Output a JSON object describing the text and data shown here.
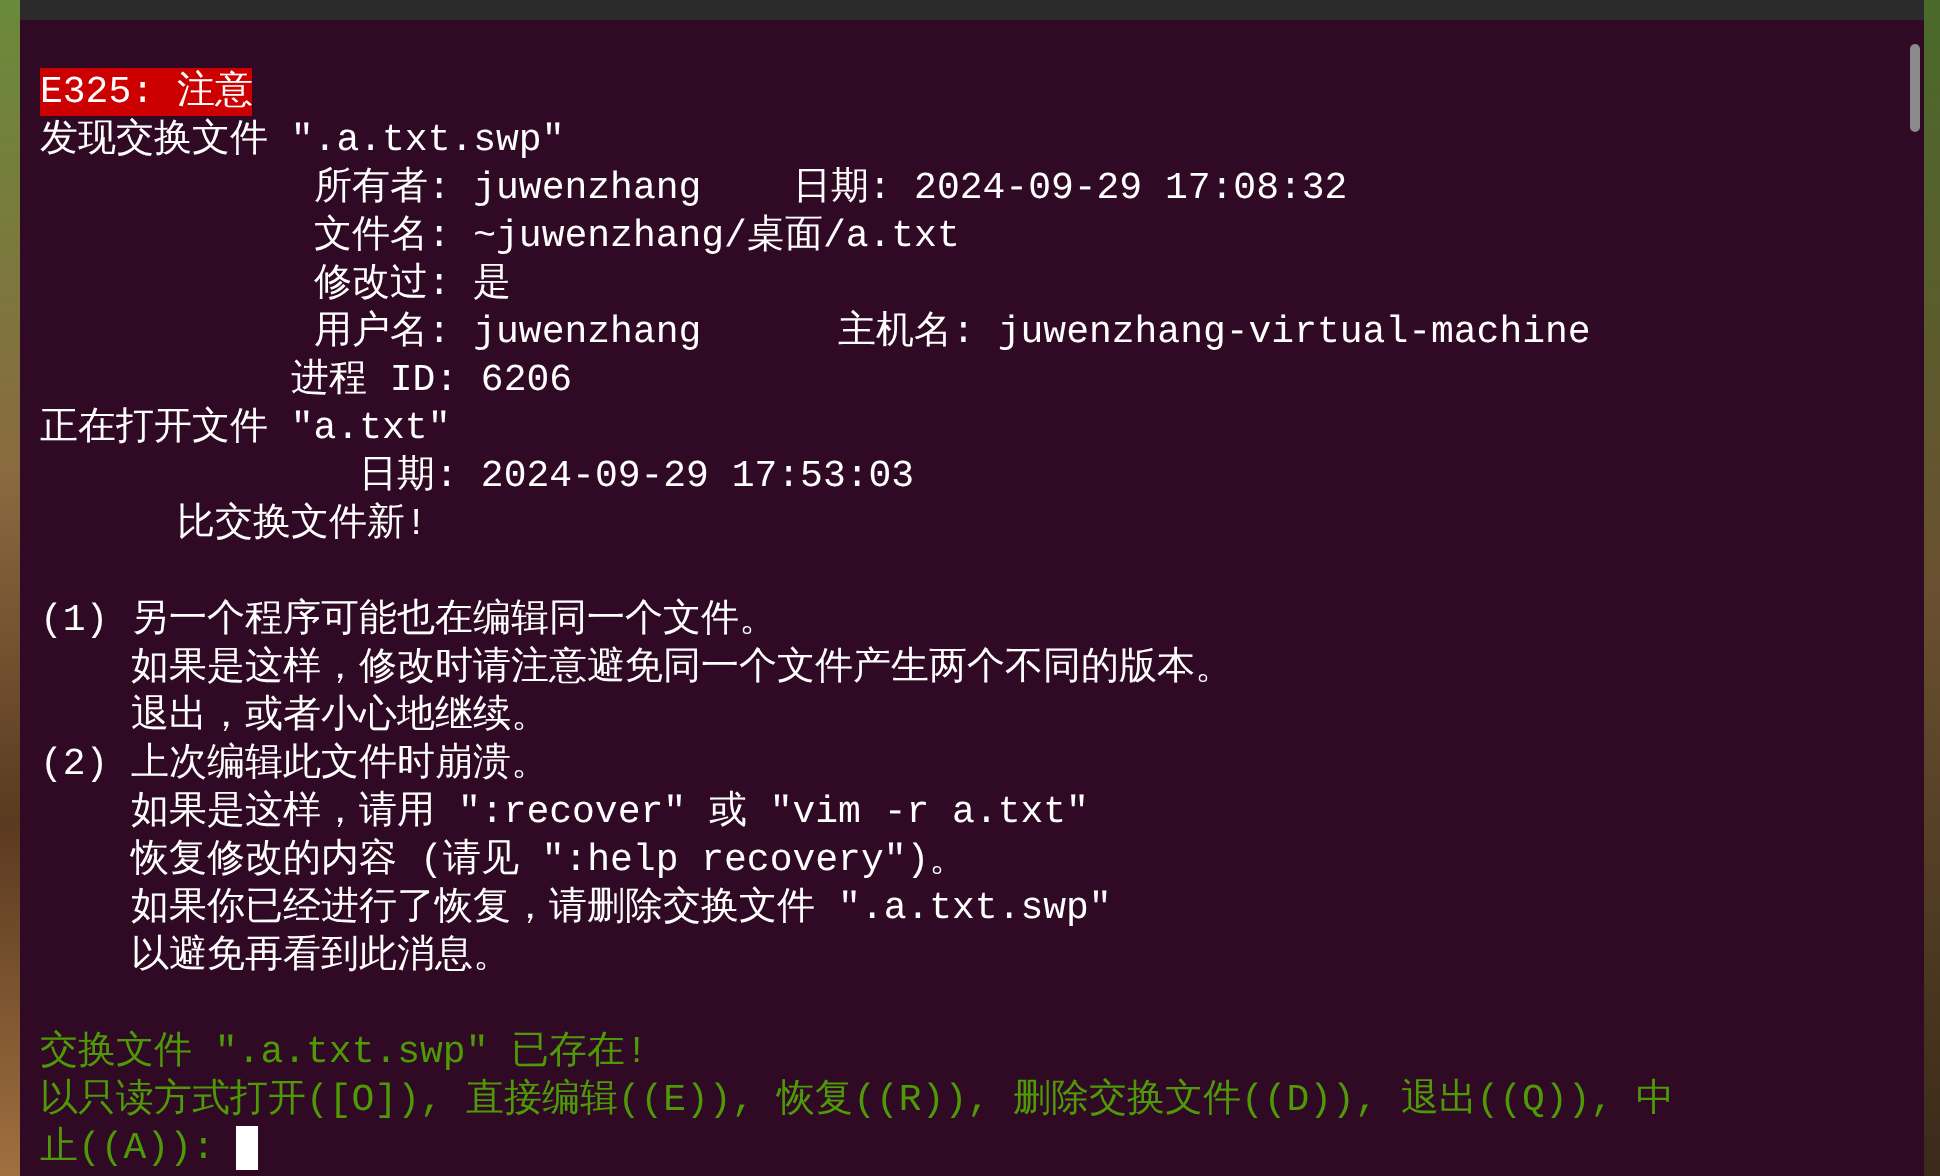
{
  "terminal": {
    "lines": [
      {
        "kind": "error",
        "text": "E325: 注意"
      },
      {
        "kind": "normal",
        "text": "发现交换文件 \".a.txt.swp\""
      },
      {
        "kind": "normal",
        "text": "            所有者: juwenzhang    日期: 2024-09-29 17:08:32"
      },
      {
        "kind": "normal",
        "text": "            文件名: ~juwenzhang/桌面/a.txt"
      },
      {
        "kind": "normal",
        "text": "            修改过: 是"
      },
      {
        "kind": "normal",
        "text": "            用户名: juwenzhang      主机名: juwenzhang-virtual-machine"
      },
      {
        "kind": "normal",
        "text": "           进程 ID: 6206"
      },
      {
        "kind": "normal",
        "text": "正在打开文件 \"a.txt\""
      },
      {
        "kind": "normal",
        "text": "              日期: 2024-09-29 17:53:03"
      },
      {
        "kind": "normal",
        "text": "      比交换文件新!"
      },
      {
        "kind": "blank"
      },
      {
        "kind": "normal",
        "text": "(1) 另一个程序可能也在编辑同一个文件。"
      },
      {
        "kind": "normal",
        "text": "    如果是这样，修改时请注意避免同一个文件产生两个不同的版本。"
      },
      {
        "kind": "normal",
        "text": "    退出，或者小心地继续。"
      },
      {
        "kind": "normal",
        "text": "(2) 上次编辑此文件时崩溃。"
      },
      {
        "kind": "normal",
        "text": "    如果是这样，请用 \":recover\" 或 \"vim -r a.txt\""
      },
      {
        "kind": "normal",
        "text": "    恢复修改的内容 (请见 \":help recovery\")。"
      },
      {
        "kind": "normal",
        "text": "    如果你已经进行了恢复，请删除交换文件 \".a.txt.swp\""
      },
      {
        "kind": "normal",
        "text": "    以避免再看到此消息。"
      },
      {
        "kind": "blank"
      },
      {
        "kind": "prompt",
        "text": "交换文件 \".a.txt.swp\" 已存在!"
      },
      {
        "kind": "prompt",
        "text": "以只读方式打开([O]), 直接编辑((E)), 恢复((R)), 删除交换文件((D)), 退出((Q)), 中"
      },
      {
        "kind": "prompt",
        "text": "止((A)):",
        "cursor": true
      }
    ]
  }
}
